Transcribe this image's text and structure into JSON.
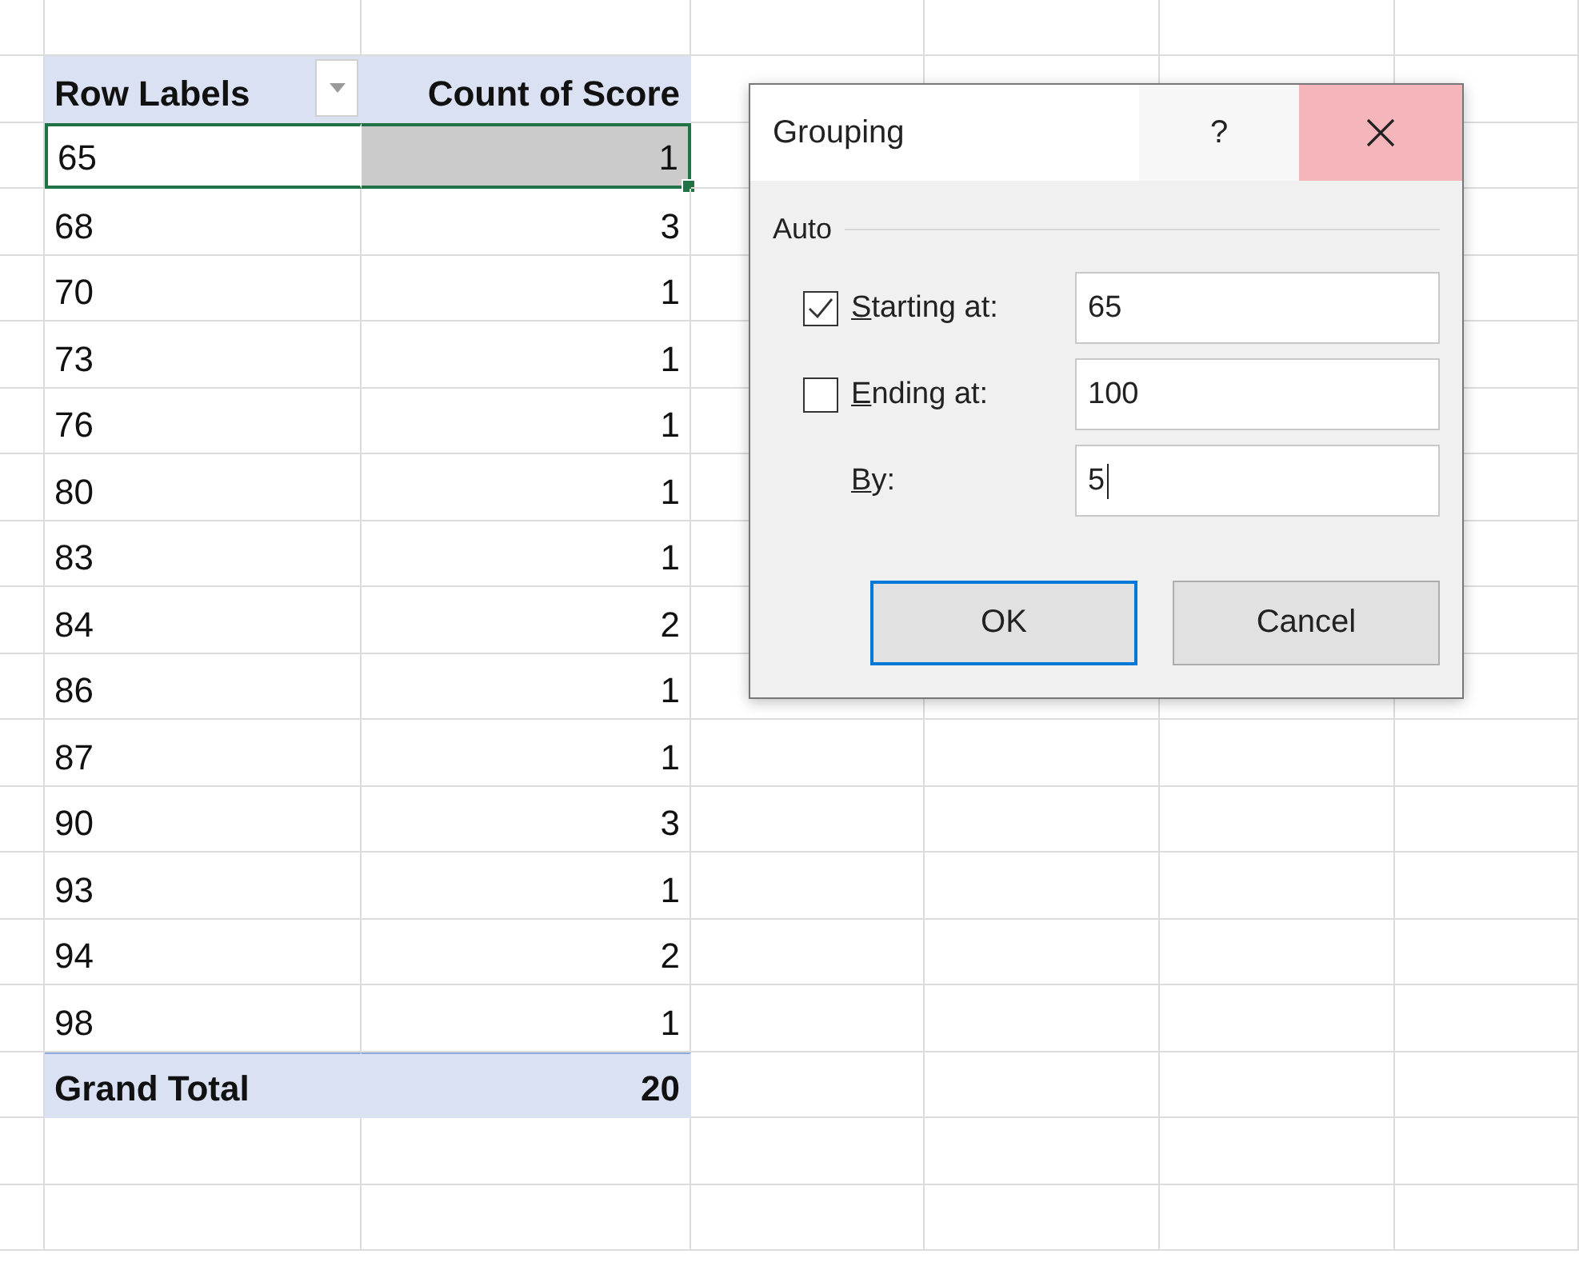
{
  "pivot_table": {
    "columns": [
      "Row Labels",
      "Count of Score"
    ],
    "rows": [
      {
        "label": "65",
        "count": "1",
        "selected": true
      },
      {
        "label": "68",
        "count": "3",
        "selected": false
      },
      {
        "label": "70",
        "count": "1",
        "selected": false
      },
      {
        "label": "73",
        "count": "1",
        "selected": false
      },
      {
        "label": "76",
        "count": "1",
        "selected": false
      },
      {
        "label": "80",
        "count": "1",
        "selected": false
      },
      {
        "label": "83",
        "count": "1",
        "selected": false
      },
      {
        "label": "84",
        "count": "2",
        "selected": false
      },
      {
        "label": "86",
        "count": "1",
        "selected": false
      },
      {
        "label": "87",
        "count": "1",
        "selected": false
      },
      {
        "label": "90",
        "count": "3",
        "selected": false
      },
      {
        "label": "93",
        "count": "1",
        "selected": false
      },
      {
        "label": "94",
        "count": "2",
        "selected": false
      },
      {
        "label": "98",
        "count": "1",
        "selected": false
      }
    ],
    "grand_total": {
      "label": "Grand Total",
      "count": "20"
    }
  },
  "dialog": {
    "title": "Grouping",
    "help": "?",
    "group_label": "Auto",
    "fields": [
      {
        "kind": "checkbox",
        "label": "Starting at:",
        "checked": true,
        "value": "65",
        "mnemonic": true
      },
      {
        "kind": "checkbox",
        "label": "Ending at:",
        "checked": false,
        "value": "100",
        "mnemonic": true
      },
      {
        "kind": "plain",
        "label": "By:",
        "value": "5",
        "mnemonic": true,
        "focused": true
      }
    ],
    "buttons": [
      {
        "label": "OK",
        "default": true
      },
      {
        "label": "Cancel",
        "default": false
      }
    ]
  }
}
